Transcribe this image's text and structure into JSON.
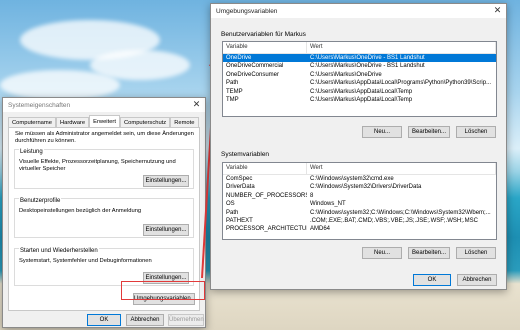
{
  "sys_props": {
    "title": "Systemeigenschaften",
    "tabs": [
      "Computername",
      "Hardware",
      "Erweitert",
      "Computerschutz",
      "Remote"
    ],
    "admin_note": "Sie müssen als Administrator angemeldet sein, um diese Änderungen durchführen zu können.",
    "perf": {
      "title": "Leistung",
      "text": "Visuelle Effekte, Prozessorzeitplanung, Speichernutzung und virtueller Speicher",
      "btn": "Einstellungen..."
    },
    "profiles": {
      "title": "Benutzerprofile",
      "text": "Desktopeinstellungen bezüglich der Anmeldung",
      "btn": "Einstellungen..."
    },
    "startup": {
      "title": "Starten und Wiederherstellen",
      "text": "Systemstart, Systemfehler und Debuginformationen",
      "btn": "Einstellungen..."
    },
    "env_btn": "Umgebungsvariablen...",
    "ok": "OK",
    "cancel": "Abbrechen",
    "apply": "Übernehmen"
  },
  "env": {
    "title": "Umgebungsvariablen",
    "user_section": "Benutzervariablen für Markus",
    "col_var": "Variable",
    "col_val": "Wert",
    "user_vars": [
      {
        "name": "OneDrive",
        "value": "C:\\Users\\Markus\\OneDrive - BS1 Landshut"
      },
      {
        "name": "OneDriveCommercial",
        "value": "C:\\Users\\Markus\\OneDrive - BS1 Landshut"
      },
      {
        "name": "OneDriveConsumer",
        "value": "C:\\Users\\Markus\\OneDrive"
      },
      {
        "name": "Path",
        "value": "C:\\Users\\Markus\\AppData\\Local\\Programs\\Python\\Python39\\Scrip..."
      },
      {
        "name": "TEMP",
        "value": "C:\\Users\\Markus\\AppData\\Local\\Temp"
      },
      {
        "name": "TMP",
        "value": "C:\\Users\\Markus\\AppData\\Local\\Temp"
      }
    ],
    "system_section": "Systemvariablen",
    "system_vars": [
      {
        "name": "ComSpec",
        "value": "C:\\Windows\\system32\\cmd.exe"
      },
      {
        "name": "DriverData",
        "value": "C:\\Windows\\System32\\Drivers\\DriverData"
      },
      {
        "name": "NUMBER_OF_PROCESSORS",
        "value": "8"
      },
      {
        "name": "OS",
        "value": "Windows_NT"
      },
      {
        "name": "Path",
        "value": "C:\\Windows\\system32;C:\\Windows;C:\\Windows\\System32\\Wbem;..."
      },
      {
        "name": "PATHEXT",
        "value": ".COM;.EXE;.BAT;.CMD;.VBS;.VBE;.JS;.JSE;.WSF;.WSH;.MSC"
      },
      {
        "name": "PROCESSOR_ARCHITECTURE",
        "value": "AMD64"
      }
    ],
    "btn_new": "Neu...",
    "btn_edit": "Bearbeiten...",
    "btn_delete": "Löschen",
    "ok": "OK",
    "cancel": "Abbrechen"
  }
}
